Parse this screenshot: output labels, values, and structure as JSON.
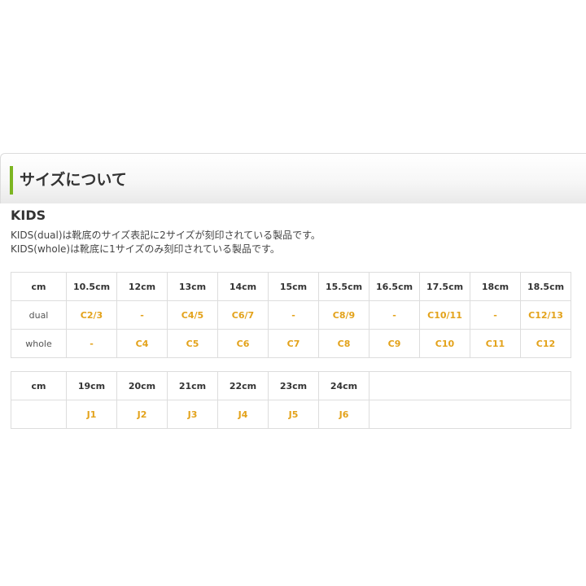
{
  "header": {
    "title": "サイズについて",
    "accent_color": "#7cb521"
  },
  "section": {
    "title": "KIDS",
    "lines": [
      "KIDS(dual)は靴底のサイズ表記に2サイズが刻印されている製品です。",
      "KIDS(whole)は靴底に1サイズのみ刻印されている製品です。"
    ]
  },
  "colors": {
    "value_text": "#e3a21a",
    "border": "#dddddd",
    "text": "#333333"
  },
  "table1": {
    "header_label": "cm",
    "sizes": [
      "10.5cm",
      "12cm",
      "13cm",
      "14cm",
      "15cm",
      "15.5cm",
      "16.5cm",
      "17.5cm",
      "18cm",
      "18.5cm"
    ],
    "rows": [
      {
        "label": "dual",
        "values": [
          "C2/3",
          "-",
          "C4/5",
          "C6/7",
          "-",
          "C8/9",
          "-",
          "C10/11",
          "-",
          "C12/13"
        ]
      },
      {
        "label": "whole",
        "values": [
          "-",
          "C4",
          "C5",
          "C6",
          "C7",
          "C8",
          "C9",
          "C10",
          "C11",
          "C12"
        ]
      }
    ]
  },
  "table2": {
    "header_label": "cm",
    "sizes": [
      "19cm",
      "20cm",
      "21cm",
      "22cm",
      "23cm",
      "24cm"
    ],
    "rows": [
      {
        "label": "",
        "values": [
          "J1",
          "J2",
          "J3",
          "J4",
          "J5",
          "J6"
        ]
      }
    ]
  }
}
